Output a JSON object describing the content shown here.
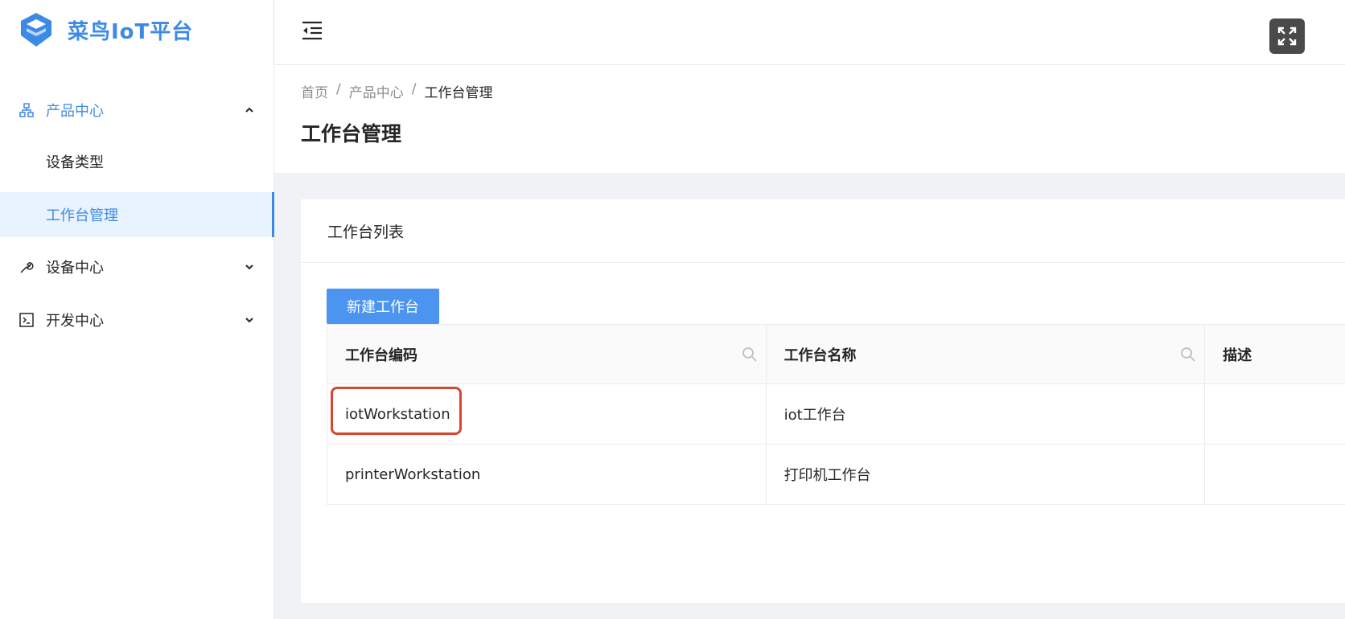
{
  "app": {
    "logo_text": "菜鸟IoT平台"
  },
  "sidebar": {
    "menus": [
      {
        "label": "产品中心",
        "icon": "sitemap-icon",
        "expanded": true,
        "children": [
          {
            "label": "设备类型"
          },
          {
            "label": "工作台管理",
            "selected": true
          }
        ]
      },
      {
        "label": "设备中心",
        "icon": "wrench-icon",
        "expanded": false
      },
      {
        "label": "开发中心",
        "icon": "terminal-icon",
        "expanded": false
      }
    ]
  },
  "header": {
    "fold_icon": "menu-fold-icon",
    "fullscreen_icon": "fullscreen-icon"
  },
  "breadcrumb": {
    "items": [
      "首页",
      "产品中心",
      "工作台管理"
    ],
    "separator": "/"
  },
  "page": {
    "title": "工作台管理"
  },
  "card": {
    "title": "工作台列表",
    "new_button": "新建工作台",
    "table": {
      "columns": [
        "工作台编码",
        "工作台名称",
        "描述"
      ],
      "rows": [
        {
          "code": "iotWorkstation",
          "name": "iot工作台",
          "desc": ""
        },
        {
          "code": "printerWorkstation",
          "name": "打印机工作台",
          "desc": ""
        }
      ]
    }
  },
  "colors": {
    "accent": "#3d8ae6",
    "button": "#4b94ef",
    "highlight": "#d9452f",
    "selected_bg": "#e8f3fd"
  }
}
